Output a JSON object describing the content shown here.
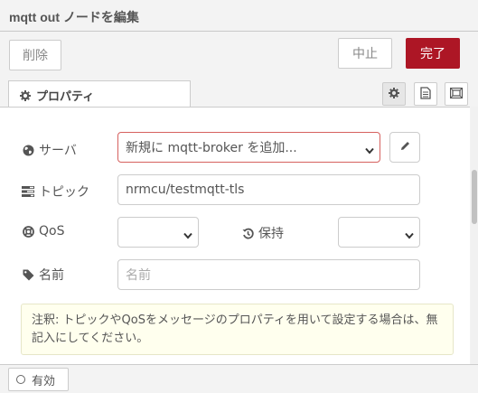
{
  "title": "mqtt out ノードを編集",
  "toolbar": {
    "delete_label": "削除",
    "cancel_label": "中止",
    "done_label": "完了"
  },
  "tabs": {
    "properties_label": "プロパティ"
  },
  "form": {
    "server": {
      "label": "サーバ",
      "value": "新規に mqtt-broker を追加..."
    },
    "topic": {
      "label": "トピック",
      "value": "nrmcu/testmqtt-tls"
    },
    "qos": {
      "label": "QoS",
      "value": ""
    },
    "retain": {
      "label": "保持",
      "value": ""
    },
    "name": {
      "label": "名前",
      "placeholder": "名前"
    }
  },
  "tip": {
    "text": "注釈: トピックやQoSをメッセージのプロパティを用いて設定する場合は、無記入にしてください。"
  },
  "footer": {
    "enabled_label": "有効"
  },
  "colors": {
    "primary": "#ad1625",
    "error_border": "#d6615f"
  }
}
